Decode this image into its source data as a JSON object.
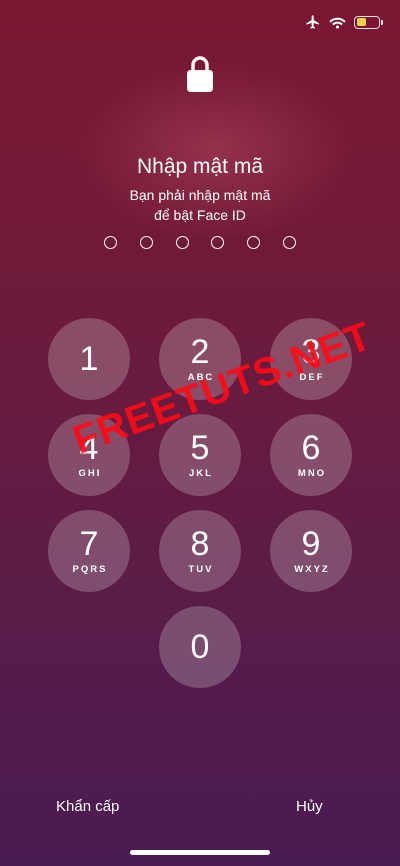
{
  "status_bar": {
    "icons": [
      "airplane-icon",
      "wifi-icon",
      "battery-icon"
    ],
    "battery_color": "#f5d04a"
  },
  "lock_icon": "lock-icon",
  "title": "Nhập mật mã",
  "subtitle_line1": "Bạn phải nhập mật mã",
  "subtitle_line2": "để bật Face ID",
  "passcode_length": 6,
  "keys": [
    {
      "digit": "1",
      "letters": ""
    },
    {
      "digit": "2",
      "letters": "ABC"
    },
    {
      "digit": "3",
      "letters": "DEF"
    },
    {
      "digit": "4",
      "letters": "GHI"
    },
    {
      "digit": "5",
      "letters": "JKL"
    },
    {
      "digit": "6",
      "letters": "MNO"
    },
    {
      "digit": "7",
      "letters": "PQRS"
    },
    {
      "digit": "8",
      "letters": "TUV"
    },
    {
      "digit": "9",
      "letters": "WXYZ"
    },
    {
      "digit": "0",
      "letters": ""
    }
  ],
  "watermark": "FREETUTS.NET",
  "emergency_label": "Khẩn cấp",
  "cancel_label": "Hủy",
  "colors": {
    "background_top": "#7a1630",
    "background_bottom": "#4a1b52",
    "watermark": "#ff0a14"
  }
}
